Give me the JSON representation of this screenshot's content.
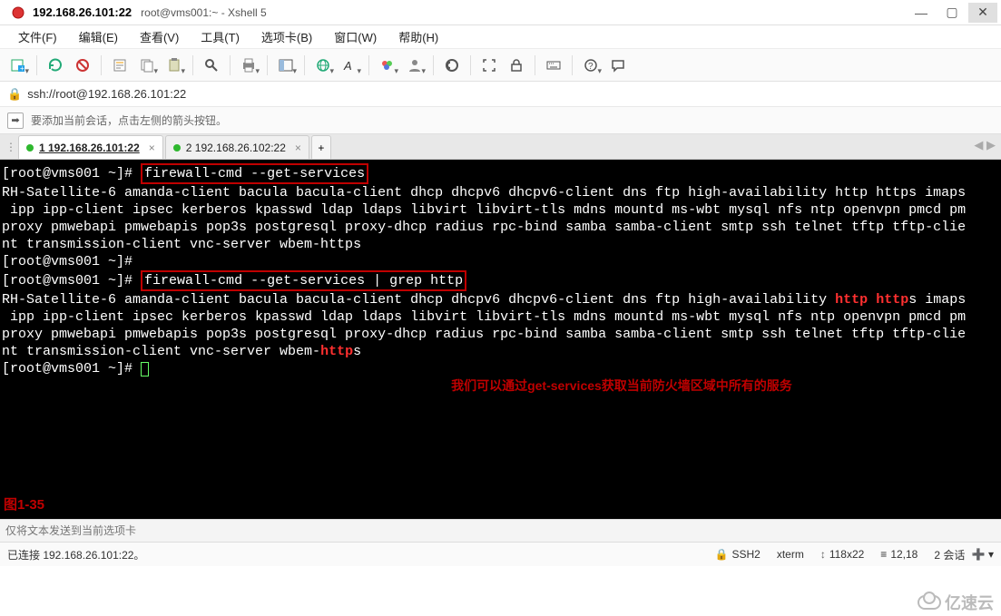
{
  "window": {
    "title": "192.168.26.101:22",
    "subtitle": "root@vms001:~ - Xshell 5"
  },
  "menu": {
    "file": "文件(F)",
    "edit": "编辑(E)",
    "view": "查看(V)",
    "tools": "工具(T)",
    "tabs": "选项卡(B)",
    "window": "窗口(W)",
    "help": "帮助(H)"
  },
  "address": "ssh://root@192.168.26.101:22",
  "hint": "要添加当前会话，点击左侧的箭头按钮。",
  "tabs": {
    "t1": "1 192.168.26.101:22",
    "t2": "2 192.168.26.102:22",
    "add": "+"
  },
  "terminal": {
    "prompt1": "[root@vms001 ~]#",
    "cmd1": "firewall-cmd --get-services",
    "out1": "RH-Satellite-6 amanda-client bacula bacula-client dhcp dhcpv6 dhcpv6-client dns ftp high-availability http https imaps\n ipp ipp-client ipsec kerberos kpasswd ldap ldaps libvirt libvirt-tls mdns mountd ms-wbt mysql nfs ntp openvpn pmcd pm\nproxy pmwebapi pmwebapis pop3s postgresql proxy-dhcp radius rpc-bind samba samba-client smtp ssh telnet tftp tftp-clie\nnt transmission-client vnc-server wbem-https",
    "prompt2": "[root@vms001 ~]#",
    "prompt3": "[root@vms001 ~]#",
    "cmd2": "firewall-cmd --get-services | grep http",
    "out2a": "RH-Satellite-6 amanda-client bacula bacula-client dhcp dhcpv6 dhcpv6-client dns ftp high-availability ",
    "out2_http": "http",
    "out2_space": " ",
    "out2_https": "http",
    "out2_https_s": "s imaps",
    "out2b": "\n ipp ipp-client ipsec kerberos kpasswd ldap ldaps libvirt libvirt-tls mdns mountd ms-wbt mysql nfs ntp openvpn pmcd pm\nproxy pmwebapi pmwebapis pop3s postgresql proxy-dhcp radius rpc-bind samba samba-client smtp ssh telnet tftp tftp-clie\nnt transmission-client vnc-server wbem-",
    "out2_http3": "http",
    "out2_s2": "s",
    "prompt4": "[root@vms001 ~]#",
    "annotation": "我们可以通过get-services获取当前防火墙区域中所有的服务",
    "figlabel": "图1-35"
  },
  "input_placeholder": "仅将文本发送到当前选项卡",
  "status": {
    "conn": "已连接 192.168.26.101:22。",
    "proto": "SSH2",
    "term": "xterm",
    "size": "118x22",
    "pos": "12,18",
    "sessions": "2 会话"
  },
  "watermark": "亿速云"
}
